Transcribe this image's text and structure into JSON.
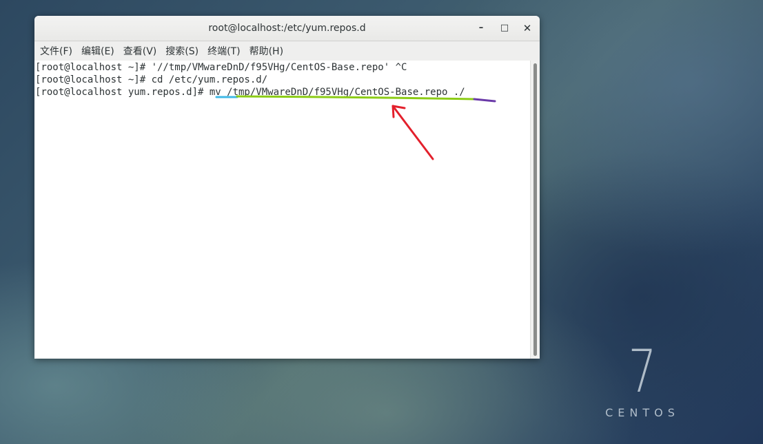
{
  "window": {
    "title": "root@localhost:/etc/yum.repos.d",
    "minimize_glyph": "–",
    "maximize_glyph": "□",
    "close_glyph": "✕"
  },
  "menu": {
    "items": [
      {
        "label": "文件(F)"
      },
      {
        "label": "编辑(E)"
      },
      {
        "label": "查看(V)"
      },
      {
        "label": "搜索(S)"
      },
      {
        "label": "终端(T)"
      },
      {
        "label": "帮助(H)"
      }
    ]
  },
  "terminal": {
    "lines": [
      "[root@localhost ~]# '//tmp/VMwareDnD/f95VHg/CentOS-Base.repo' ^C",
      "[root@localhost ~]# cd /etc/yum.repos.d/",
      "[root@localhost yum.repos.d]# mv /tmp/VMwareDnD/f95VHg/CentOS-Base.repo ./"
    ]
  },
  "annotations": {
    "underline_colors": {
      "command": "#3fb8e6",
      "source": "#8ccc16",
      "destination": "#6a3aa8"
    },
    "arrow_color": "#e3202c"
  },
  "desktop": {
    "brand_number": "7",
    "brand_name": "CENTOS"
  }
}
